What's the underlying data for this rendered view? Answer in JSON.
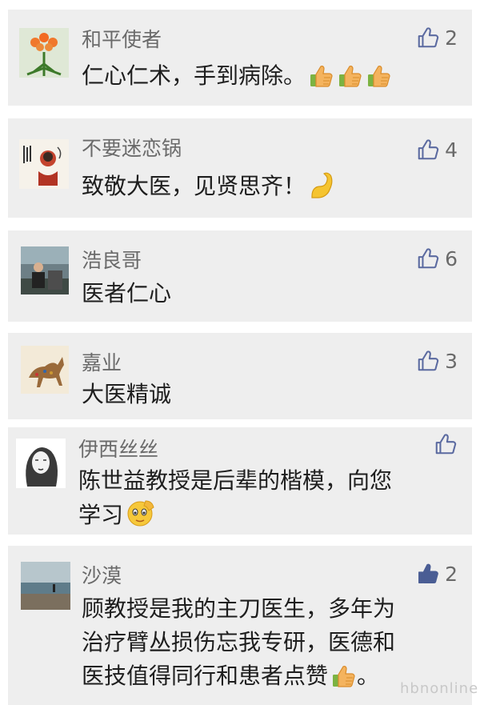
{
  "comments": [
    {
      "author": "和平使者",
      "likes": "2",
      "text": "仁心仁术，手到病除。",
      "emoji": "thumbs-up-emoji x3",
      "liked": false
    },
    {
      "author": "不要迷恋锅",
      "likes": "4",
      "text": "致敬大医，见贤思齐！",
      "emoji": "flexed-biceps-emoji",
      "liked": false
    },
    {
      "author": "浩良哥",
      "likes": "6",
      "text": "医者仁心",
      "liked": false
    },
    {
      "author": "嘉业",
      "likes": "3",
      "text": "大医精诚",
      "liked": false
    },
    {
      "author": "伊西丝丝",
      "likes": "",
      "text_line1": "陈世益教授是后辈的楷模，向您",
      "text_line2": "学习",
      "emoji": "saluting-face-emoji",
      "liked": false
    },
    {
      "author": "沙漠",
      "likes": "2",
      "text_line1": "顾教授是我的主刀医生，多年为",
      "text_line2": "治疗臂丛损伤忘我专研，医德和",
      "text_line3": "医技值得同行和患者点赞",
      "text_tail": "。",
      "emoji": "thumbs-up-emoji",
      "liked": true
    }
  ],
  "colors": {
    "card_bg": "#eeeeee",
    "author": "#6a6a6a",
    "text": "#1e1e1e",
    "like_outline": "#5b6aa0",
    "like_filled": "#4a5d94"
  },
  "watermark": "hbnonline"
}
